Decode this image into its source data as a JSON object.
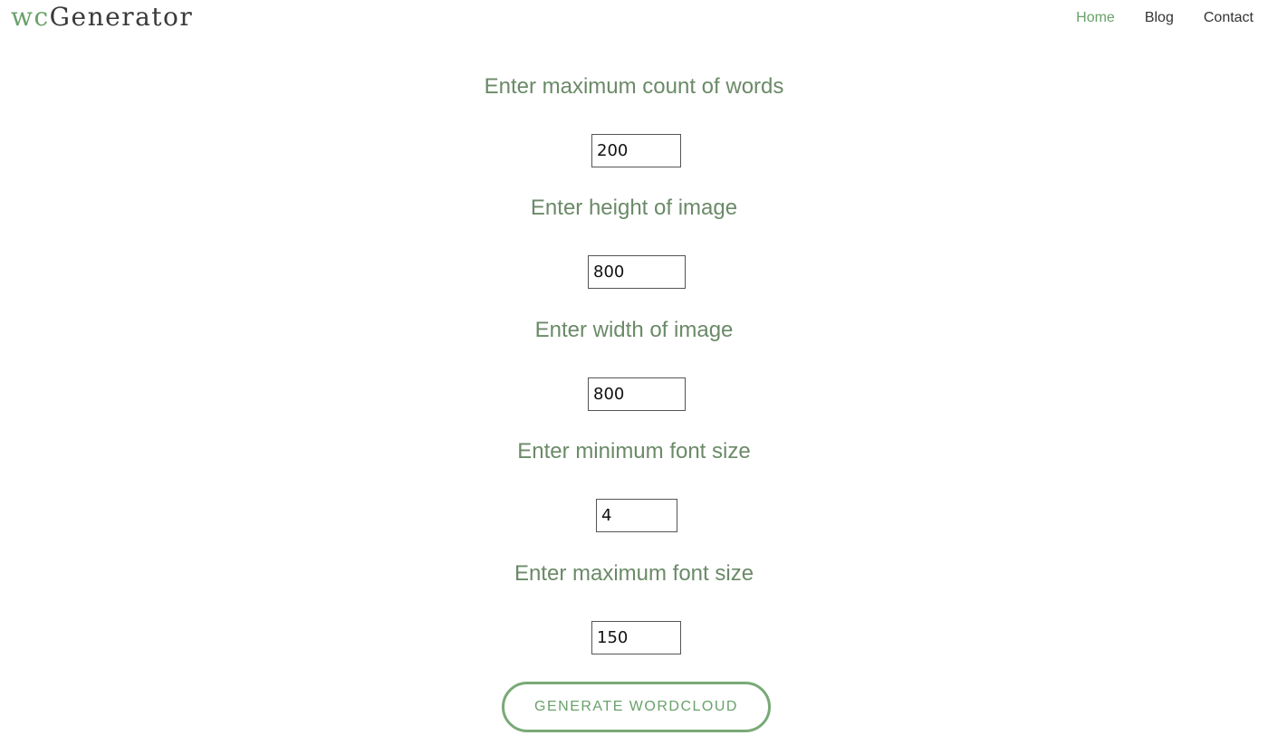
{
  "brand": {
    "accent_text": "wc",
    "rest_text": "Generator"
  },
  "nav": {
    "items": [
      {
        "label": "Home",
        "active": true
      },
      {
        "label": "Blog",
        "active": false
      },
      {
        "label": "Contact",
        "active": false
      }
    ]
  },
  "form": {
    "max_words": {
      "label": "Enter maximum count of words",
      "value": "200"
    },
    "height": {
      "label": "Enter height of image",
      "value": "800"
    },
    "width": {
      "label": "Enter width of image",
      "value": "800"
    },
    "min_font": {
      "label": "Enter minimum font size",
      "value": "4"
    },
    "max_font": {
      "label": "Enter maximum font size",
      "value": "150"
    },
    "submit_label": "GENERATE WORDCLOUD"
  },
  "colors": {
    "accent": "#6aa16a",
    "label_text": "#6b8a68",
    "nav_text": "#333333"
  }
}
